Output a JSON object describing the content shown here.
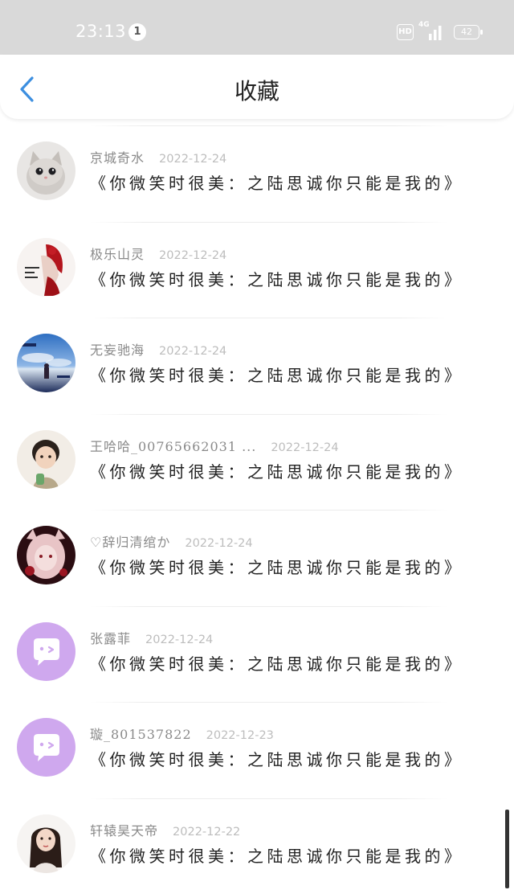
{
  "status_bar": {
    "time": "23:13",
    "notification_count": "1",
    "hd_label": "HD",
    "network_label": "4G",
    "battery": "42"
  },
  "header": {
    "title": "收藏",
    "back_icon": "chevron-left-icon"
  },
  "colors": {
    "accent": "#3d8fe0",
    "status_bar_bg": "#d9d9d9"
  },
  "items": [
    {
      "username": "京城奇水",
      "date": "2022-12-24",
      "title": "《你微笑时很美：之陆思诚你只能是我的》",
      "avatar": "cat-avatar"
    },
    {
      "username": "极乐山灵",
      "date": "2022-12-24",
      "title": "《你微笑时很美：之陆思诚你只能是我的》",
      "avatar": "red-figure-avatar"
    },
    {
      "username": "无妄驰海",
      "date": "2022-12-24",
      "title": "《你微笑时很美：之陆思诚你只能是我的》",
      "avatar": "sky-sea-avatar"
    },
    {
      "username": "王哈哈_00765662031 ...",
      "date": "2022-12-24",
      "title": "《你微笑时很美：之陆思诚你只能是我的》",
      "avatar": "child-avatar"
    },
    {
      "username": "♡辞归清绾か",
      "date": "2022-12-24",
      "title": "《你微笑时很美：之陆思诚你只能是我的》",
      "avatar": "anime-girl-avatar"
    },
    {
      "username": "张露菲",
      "date": "2022-12-24",
      "title": "《你微笑时很美：之陆思诚你只能是我的》",
      "avatar": "default-chat-avatar"
    },
    {
      "username": "璇_801537822",
      "date": "2022-12-23",
      "title": "《你微笑时很美：之陆思诚你只能是我的》",
      "avatar": "default-chat-avatar"
    },
    {
      "username": "轩辕昊天帝",
      "date": "2022-12-22",
      "title": "《你微笑时很美：之陆思诚你只能是我的》",
      "avatar": "woman-portrait-avatar"
    }
  ]
}
